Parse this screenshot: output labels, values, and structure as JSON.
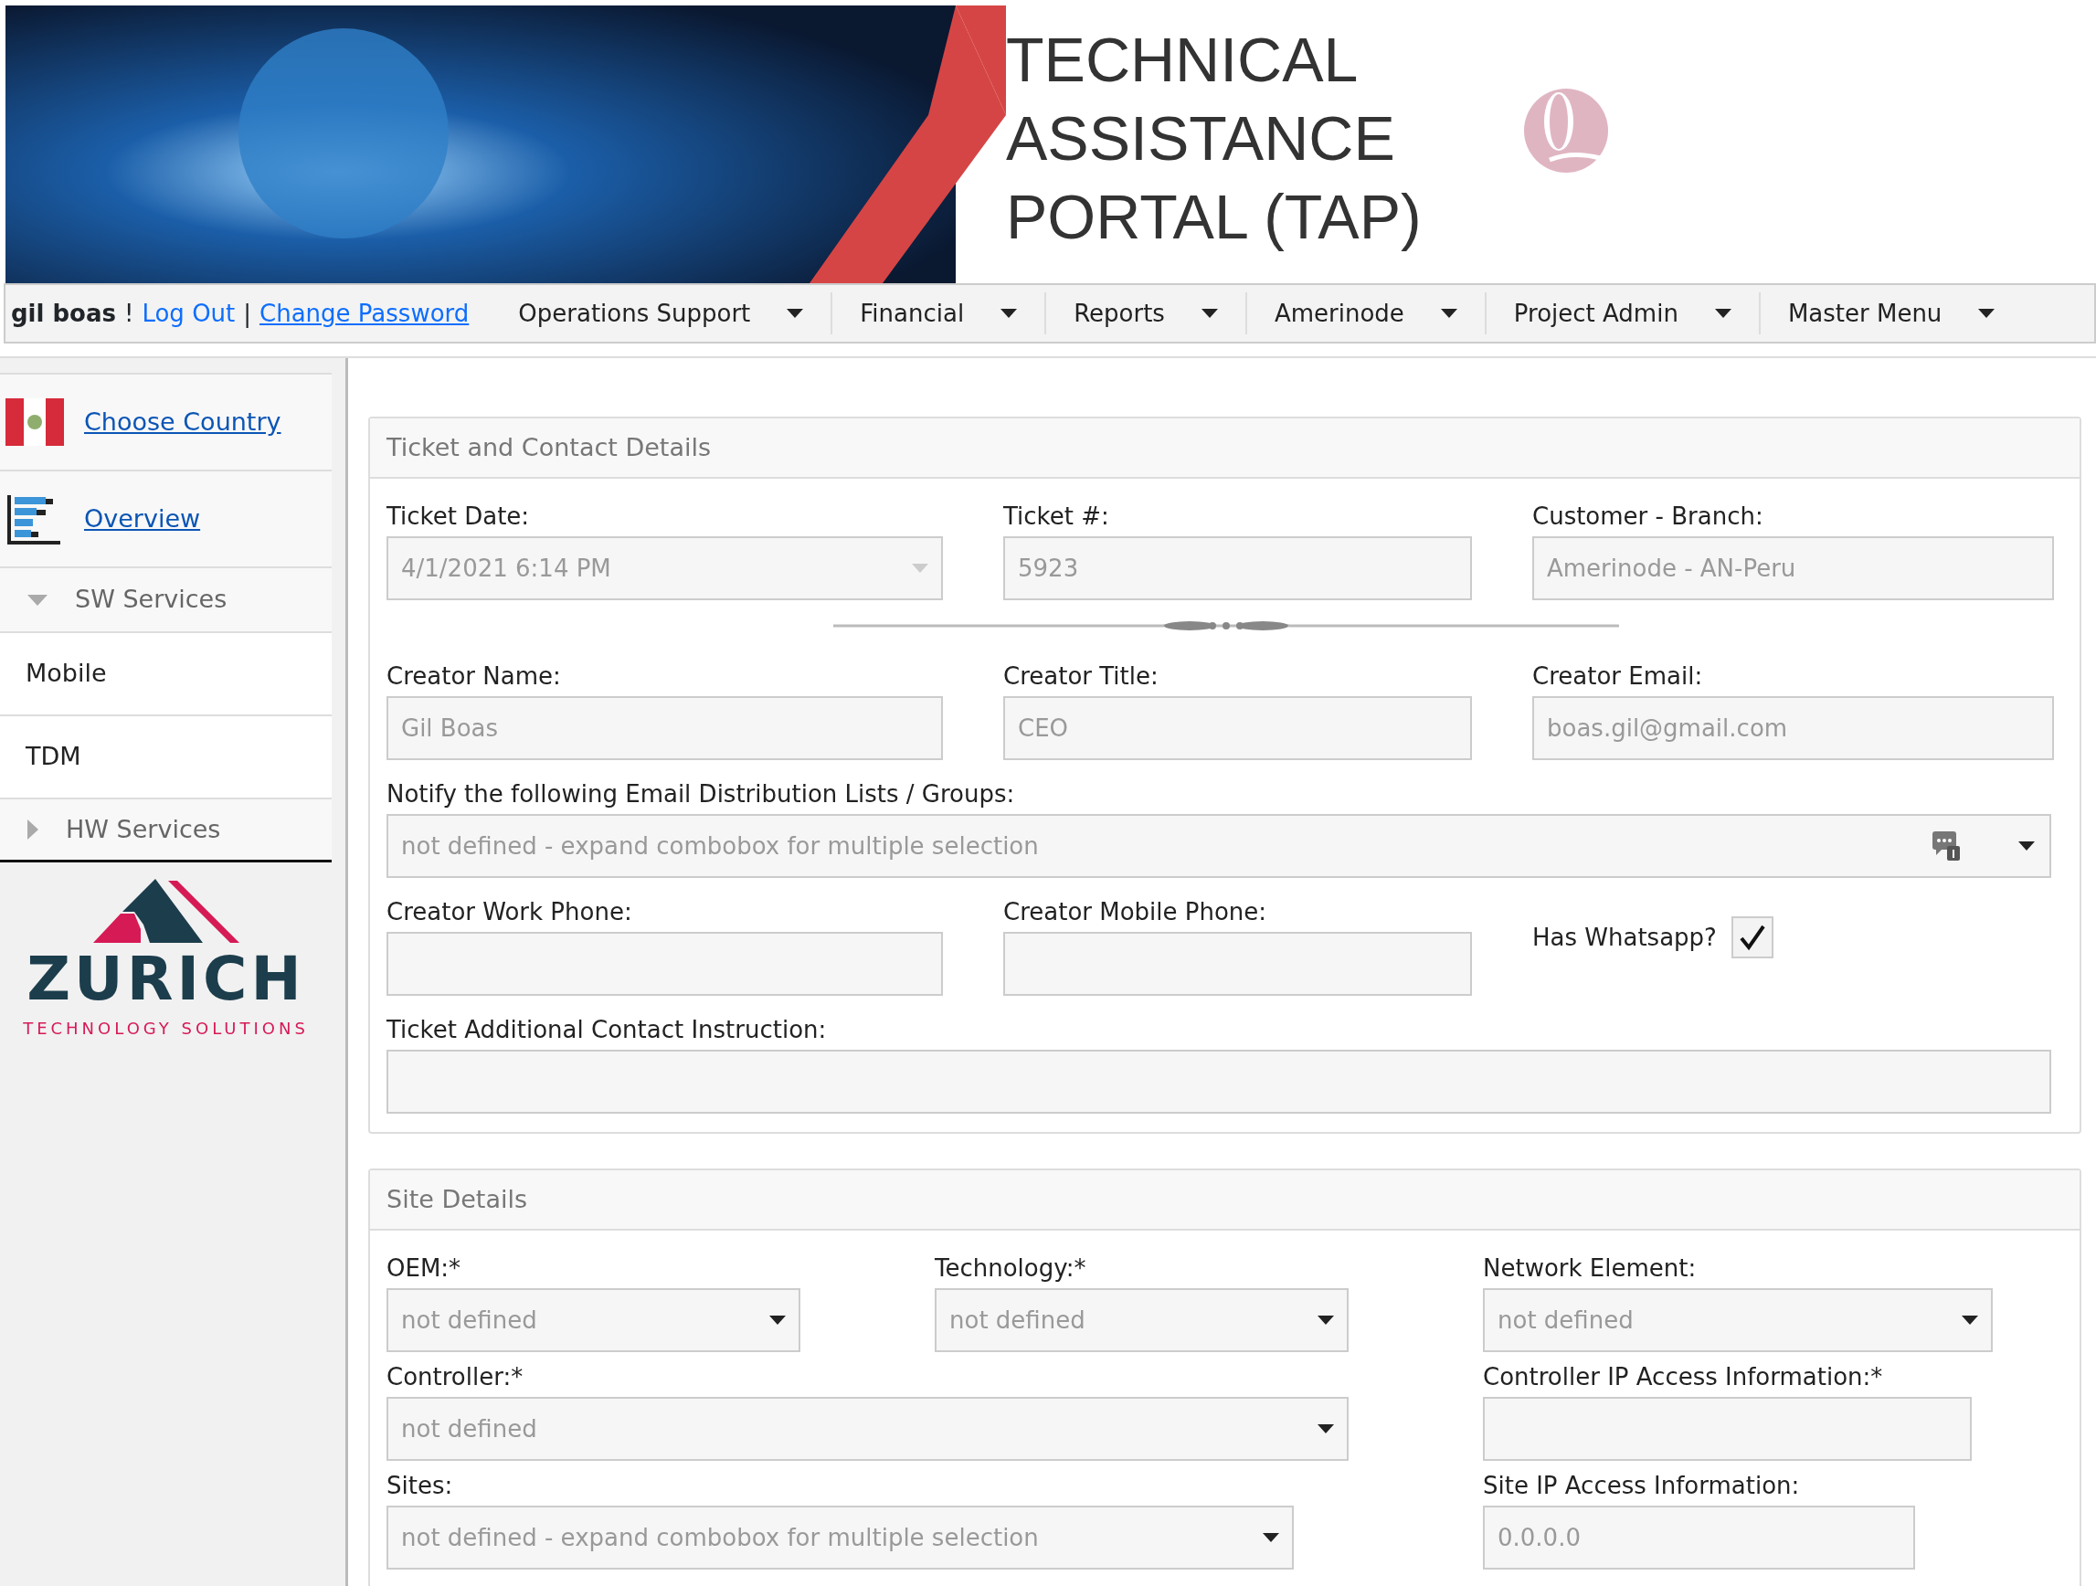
{
  "header": {
    "title_lines": [
      "TECHNICAL",
      "ASSISTANCE",
      "PORTAL (TAP)"
    ]
  },
  "nav": {
    "user": "gil boas",
    "exclaim": "!",
    "logout": "Log Out",
    "separator": "|",
    "change_password": "Change Password",
    "menus": [
      "Operations Support",
      "Financial",
      "Reports",
      "Amerinode",
      "Project Admin",
      "Master Menu"
    ]
  },
  "sidebar": {
    "items": [
      {
        "kind": "flag-link",
        "label": "Choose Country"
      },
      {
        "kind": "chart-link",
        "label": "Overview"
      },
      {
        "kind": "group",
        "label": "SW Services",
        "expanded": true
      },
      {
        "kind": "item",
        "label": "Mobile"
      },
      {
        "kind": "item",
        "label": "TDM"
      },
      {
        "kind": "group",
        "label": "HW Services",
        "expanded": false
      }
    ],
    "logo": {
      "name": "ZURICH",
      "tagline": "TECHNOLOGY SOLUTIONS"
    }
  },
  "ticket_section": {
    "title": "Ticket and Contact Details",
    "rows": [
      [
        {
          "kind": "date",
          "label": "Ticket Date:",
          "value": "4/1/2021 6:14 PM"
        },
        {
          "kind": "text",
          "label": "Ticket #:",
          "value": "5923"
        },
        {
          "kind": "text",
          "label": "Customer - Branch:",
          "value": "Amerinode - AN-Peru"
        }
      ],
      [
        {
          "kind": "divider"
        }
      ],
      [
        {
          "kind": "text",
          "label": "Creator Name:",
          "value": "Gil Boas"
        },
        {
          "kind": "text",
          "label": "Creator Title:",
          "value": "CEO"
        },
        {
          "kind": "text",
          "label": "Creator Email:",
          "value": "boas.gil@gmail.com"
        }
      ],
      [
        {
          "kind": "multiselect",
          "label": "Notify the following Email Distribution Lists / Groups:",
          "value": "not defined - expand combobox for multiple selection"
        }
      ],
      [
        {
          "kind": "text",
          "label": "Creator Work Phone:"
        },
        {
          "kind": "text",
          "label": "Creator Mobile Phone:"
        },
        {
          "kind": "checkbox",
          "label": "Has Whatsapp?",
          "checked": true
        }
      ],
      [
        {
          "kind": "wide-text",
          "label": "Ticket Additional Contact Instruction:"
        }
      ]
    ]
  },
  "site_section": {
    "title": "Site Details",
    "rows": [
      [
        {
          "kind": "select",
          "label": "OEM:*",
          "value": "not defined"
        },
        {
          "kind": "select",
          "label": "Technology:*",
          "value": "not defined"
        },
        {
          "kind": "select",
          "label": "Network Element:",
          "value": "not defined"
        }
      ],
      [
        {
          "kind": "select",
          "label": "Controller:*",
          "value": "not defined"
        },
        {
          "kind": "text",
          "label": "Controller IP Access Information:*"
        }
      ],
      [
        {
          "kind": "select",
          "label": "Sites:",
          "value": "not defined - expand combobox for multiple selection"
        },
        {
          "kind": "text",
          "label": "Site IP Access Information:",
          "value": "0.0.0.0"
        }
      ]
    ]
  }
}
